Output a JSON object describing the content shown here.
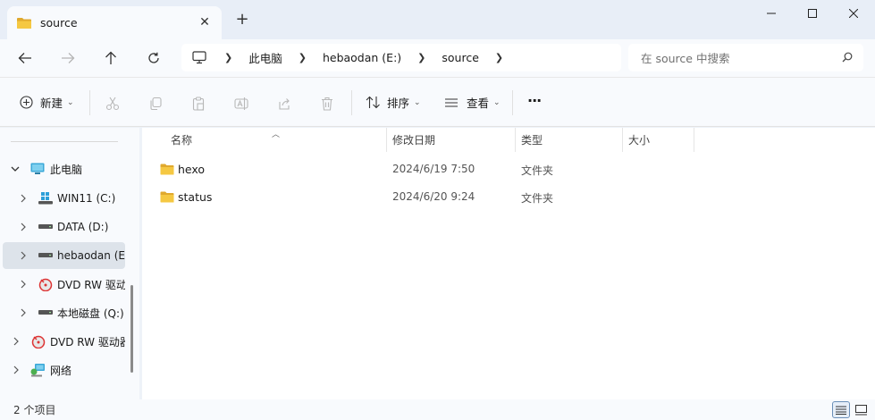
{
  "tab": {
    "title": "source",
    "close_glyph": "✕",
    "new_tab_glyph": "+"
  },
  "window_controls": {
    "minimize": "minimize-icon",
    "maximize": "maximize-icon",
    "close": "close-icon"
  },
  "nav": {
    "back": "arrow-left-icon",
    "forward": "arrow-right-icon",
    "up": "arrow-up-icon",
    "refresh": "refresh-icon"
  },
  "breadcrumb": [
    "此电脑",
    "hebaodan (E:)",
    "source"
  ],
  "search": {
    "placeholder": "在 source 中搜索"
  },
  "toolbar": {
    "new_label": "新建",
    "sort_label": "排序",
    "view_label": "查看",
    "more_label": "···"
  },
  "sidebar": {
    "items": [
      {
        "label": "此电脑",
        "level": 0,
        "expanded": true,
        "icon": "monitor-icon"
      },
      {
        "label": "WIN11 (C:)",
        "level": 1,
        "icon": "windows-drive-icon"
      },
      {
        "label": "DATA (D:)",
        "level": 1,
        "icon": "drive-icon"
      },
      {
        "label": "hebaodan (E:)",
        "level": 1,
        "icon": "drive-icon",
        "selected": true
      },
      {
        "label": "DVD RW 驱动器",
        "level": 1,
        "icon": "dvd-icon"
      },
      {
        "label": "本地磁盘 (Q:)",
        "level": 1,
        "icon": "drive-icon"
      },
      {
        "label": "DVD RW 驱动器",
        "level": 0,
        "icon": "dvd-icon"
      },
      {
        "label": "网络",
        "level": 0,
        "icon": "network-icon"
      }
    ]
  },
  "columns": {
    "name": "名称",
    "date": "修改日期",
    "type": "类型",
    "size": "大小"
  },
  "files": [
    {
      "name": "hexo",
      "date": "2024/6/19 7:50",
      "type": "文件夹"
    },
    {
      "name": "status",
      "date": "2024/6/20 9:24",
      "type": "文件夹"
    }
  ],
  "status": {
    "count_text": "2 个项目"
  },
  "colors": {
    "folder": "#f2c94c",
    "folder_dark": "#e0a92e",
    "accent": "#0067c0"
  }
}
